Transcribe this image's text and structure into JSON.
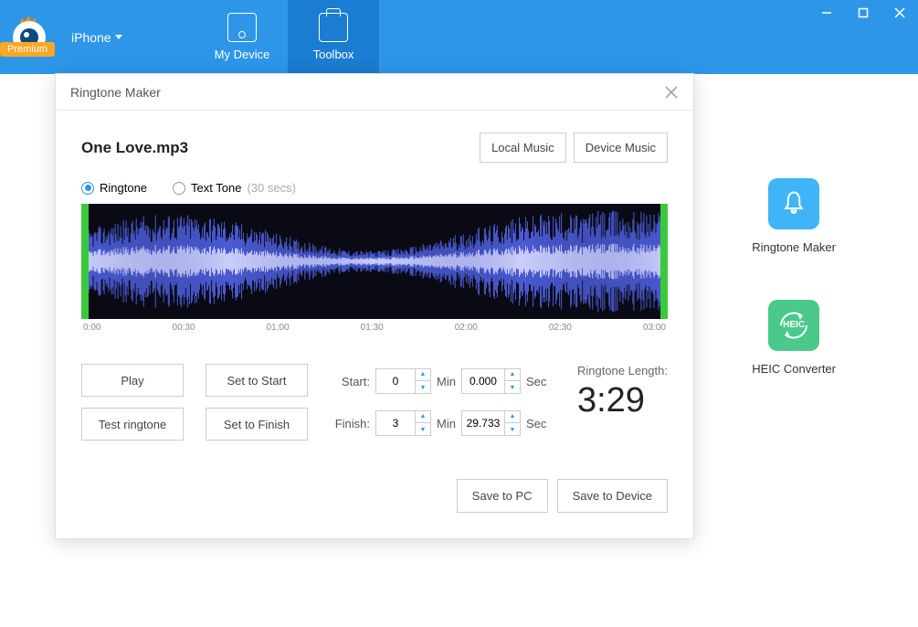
{
  "topbar": {
    "premium": "Premium",
    "device": "iPhone",
    "tabs": {
      "my_device": "My Device",
      "toolbox": "Toolbox"
    }
  },
  "toolbox_side": {
    "ringtone": "Ringtone Maker",
    "heic": "HEIC Converter",
    "heic_badge": "HEIC"
  },
  "dialog": {
    "title": "Ringtone Maker",
    "file": "One Love.mp3",
    "local_music": "Local Music",
    "device_music": "Device Music",
    "radio": {
      "ringtone": "Ringtone",
      "text_tone": "Text Tone",
      "text_tone_hint": "(30 secs)"
    },
    "ruler": [
      "0:00",
      "00:30",
      "01:00",
      "01:30",
      "02:00",
      "02:30",
      "03:00"
    ],
    "play": "Play",
    "test": "Test ringtone",
    "set_start": "Set to Start",
    "set_finish": "Set to Finish",
    "start_label": "Start:",
    "finish_label": "Finish:",
    "min_unit": "Min",
    "sec_unit": "Sec",
    "start_min": "0",
    "start_sec": "0.000",
    "finish_min": "3",
    "finish_sec": "29.733",
    "length_label": "Ringtone Length:",
    "length_value": "3:29",
    "save_pc": "Save to PC",
    "save_device": "Save to Device"
  }
}
